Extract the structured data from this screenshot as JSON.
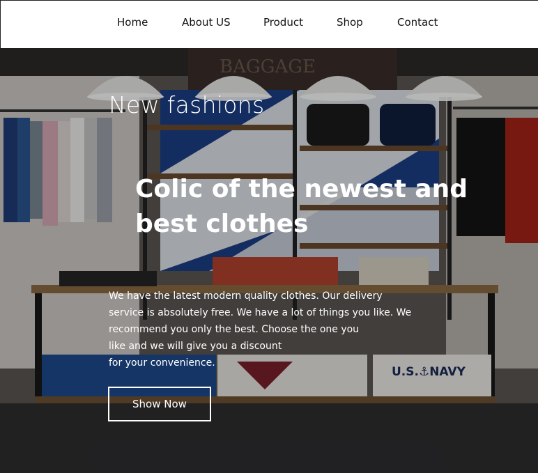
{
  "nav": {
    "items": [
      {
        "label": "Home"
      },
      {
        "label": "About US"
      },
      {
        "label": "Product"
      },
      {
        "label": "Shop"
      },
      {
        "label": "Contact"
      }
    ]
  },
  "hero": {
    "subtitle": "New fashions",
    "headline": "Colic of the newest and best clothes",
    "description": "We have the latest modern quality clothes. Our delivery\nservice is absolutely free. We have a lot of things you like. We\nrecommend you only the best. Choose the one you\nlike and we will give you a discount\nfor your convenience.",
    "button_label": "Show Now",
    "background_image": "clothing-store-interior-photo",
    "store_signs": {
      "banner": "BAGGAGE",
      "sweater": "U.S.⚓NAVY"
    }
  }
}
